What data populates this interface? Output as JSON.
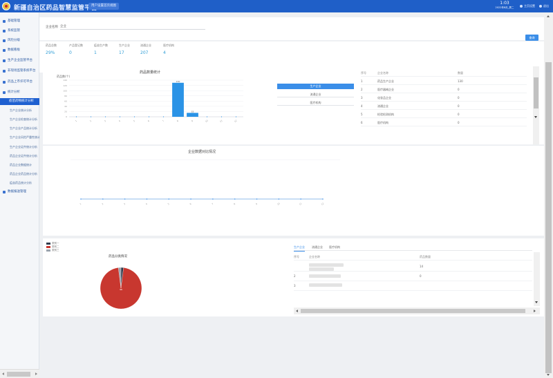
{
  "header": {
    "title": "新疆自治区药品智慧监管平台",
    "tab": "用户设置首页视图",
    "time": "1:03",
    "date": "2022年8月_周二",
    "btn_user": "主页设置",
    "btn_exit": "退出"
  },
  "sidebar": {
    "items": [
      {
        "label": "基础管理"
      },
      {
        "label": "系统监管"
      },
      {
        "label": "风险分级"
      },
      {
        "label": "数据看板"
      },
      {
        "label": "生产企业监管平台"
      },
      {
        "label": "非现场监管系统平台"
      },
      {
        "label": "药品上市许可平台"
      },
      {
        "label": "统计分析"
      },
      {
        "label": "疫苗药物统计分析"
      }
    ],
    "subs": [
      {
        "label": "生产企业统计分析"
      },
      {
        "label": "生产企业检查统计分析"
      },
      {
        "label": "生产企业产品统计分析"
      },
      {
        "label": "生产企业风险严重性统计分析"
      },
      {
        "label": "生产企业证件统计分析"
      },
      {
        "label": "药品企业证件统计分析"
      },
      {
        "label": "药品企业数据统计"
      },
      {
        "label": "药品企业药品统计分析"
      },
      {
        "label": "疫苗药品统计分析"
      }
    ],
    "last": {
      "label": "数据报送管理"
    }
  },
  "search": {
    "label": "企业名称",
    "value": "企业",
    "button": "查询"
  },
  "stats": [
    {
      "label": "药品总数",
      "value": "29%"
    },
    {
      "label": "产品登记数",
      "value": "0"
    },
    {
      "label": "疫苗生产数",
      "value": "1"
    },
    {
      "label": "生产企业",
      "value": "17"
    },
    {
      "label": "流通企业",
      "value": "207"
    },
    {
      "label": "医疗机构",
      "value": "4"
    }
  ],
  "colors": {
    "brand": "#1f5fc8",
    "accent": "#3b8ee8",
    "pie_red": "#c8372f",
    "pie_dark": "#2f3b4c",
    "pie_gray": "#9aa3ad"
  },
  "chart_data": [
    {
      "type": "bar",
      "title": "药品数量统计",
      "ylabel": "药品数(个)",
      "categories": [
        "1",
        "2",
        "3",
        "4",
        "5",
        "6",
        "7",
        "8",
        "9",
        "10",
        "11",
        "12"
      ],
      "values": [
        0,
        0,
        0,
        0,
        0,
        0,
        0,
        130,
        15,
        0,
        0,
        0
      ],
      "yticks": [
        "0",
        "20",
        "40",
        "60",
        "80",
        "100",
        "120",
        "140"
      ],
      "data_labels": [
        "130",
        "15"
      ],
      "ylim": [
        0,
        140
      ],
      "grid": true
    },
    {
      "type": "line",
      "title": "企业数据对比情况",
      "categories": [
        "1",
        "2",
        "3",
        "4",
        "5",
        "6",
        "7",
        "8",
        "9",
        "10",
        "11",
        "12"
      ],
      "values": [
        0,
        0,
        0,
        0,
        0,
        0,
        0,
        0,
        0,
        0,
        0,
        0
      ]
    },
    {
      "type": "pie",
      "title": "药品分类情况",
      "labels": [
        "类别一",
        "类别二",
        "类别三"
      ],
      "values": [
        2,
        96,
        2
      ],
      "data_labels": [
        "96"
      ],
      "legend": "top-left"
    }
  ],
  "tabs_mid": [
    "生产企业",
    "流通企业",
    "医疗机构"
  ],
  "table_top": {
    "headers": [
      "序号",
      "企业名称",
      "数量"
    ],
    "rows": [
      {
        "no": "1",
        "name": "药品生产企业",
        "count": "130"
      },
      {
        "no": "2",
        "name": "医疗器械企业",
        "count": "0"
      },
      {
        "no": "3",
        "name": "化妆品企业",
        "count": "0"
      },
      {
        "no": "4",
        "name": "流通企业",
        "count": "0"
      },
      {
        "no": "5",
        "name": "检验检测机构",
        "count": "0"
      },
      {
        "no": "6",
        "name": "医疗机构",
        "count": "0"
      }
    ]
  },
  "bottom_tabs": [
    "生产企业",
    "流通企业",
    "医疗机构"
  ],
  "table_bottom": {
    "headers": [
      "序号",
      "企业名称",
      "药品数量"
    ],
    "rows": [
      {
        "no": "",
        "count": "14"
      },
      {
        "no": "2",
        "count": "0"
      },
      {
        "no": "3",
        "count": ""
      }
    ]
  }
}
